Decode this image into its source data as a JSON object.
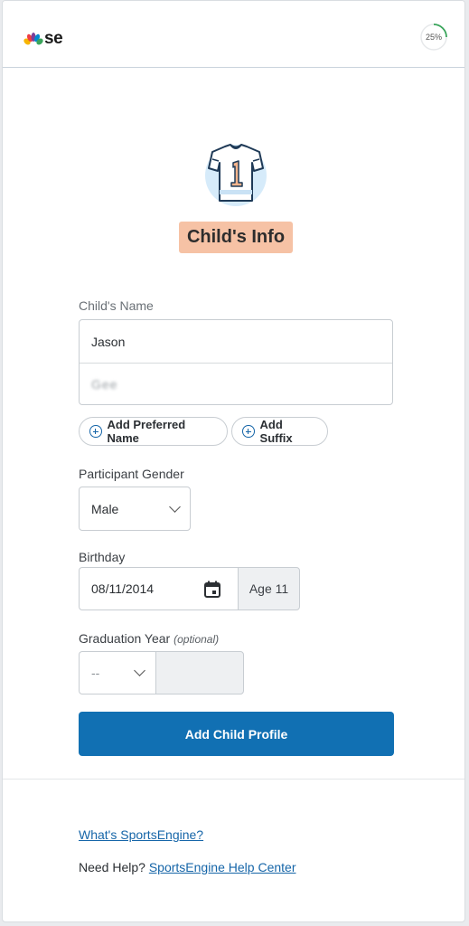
{
  "header": {
    "brand": "se",
    "progress": "25%",
    "progress_fraction": 0.25
  },
  "page": {
    "title": "Child's Info"
  },
  "form": {
    "child_name_label": "Child's Name",
    "first_name": "Jason",
    "last_name": "Gee",
    "add_preferred_name": "Add Preferred Name",
    "add_suffix": "Add Suffix",
    "gender_label": "Participant Gender",
    "gender_value": "Male",
    "birthday_label": "Birthday",
    "birthday_value": "08/11/2014",
    "age_text": "Age 11",
    "graduation_label": "Graduation Year",
    "graduation_optional": "(optional)",
    "graduation_select": "--",
    "submit_label": "Add Child Profile"
  },
  "footer": {
    "whats_link": "What's SportsEngine?",
    "need_help": "Need Help?",
    "help_link": "SportsEngine Help Center"
  },
  "colors": {
    "primary": "#1170b3",
    "badge": "#f6c2a5",
    "progress": "#3aa55b"
  }
}
